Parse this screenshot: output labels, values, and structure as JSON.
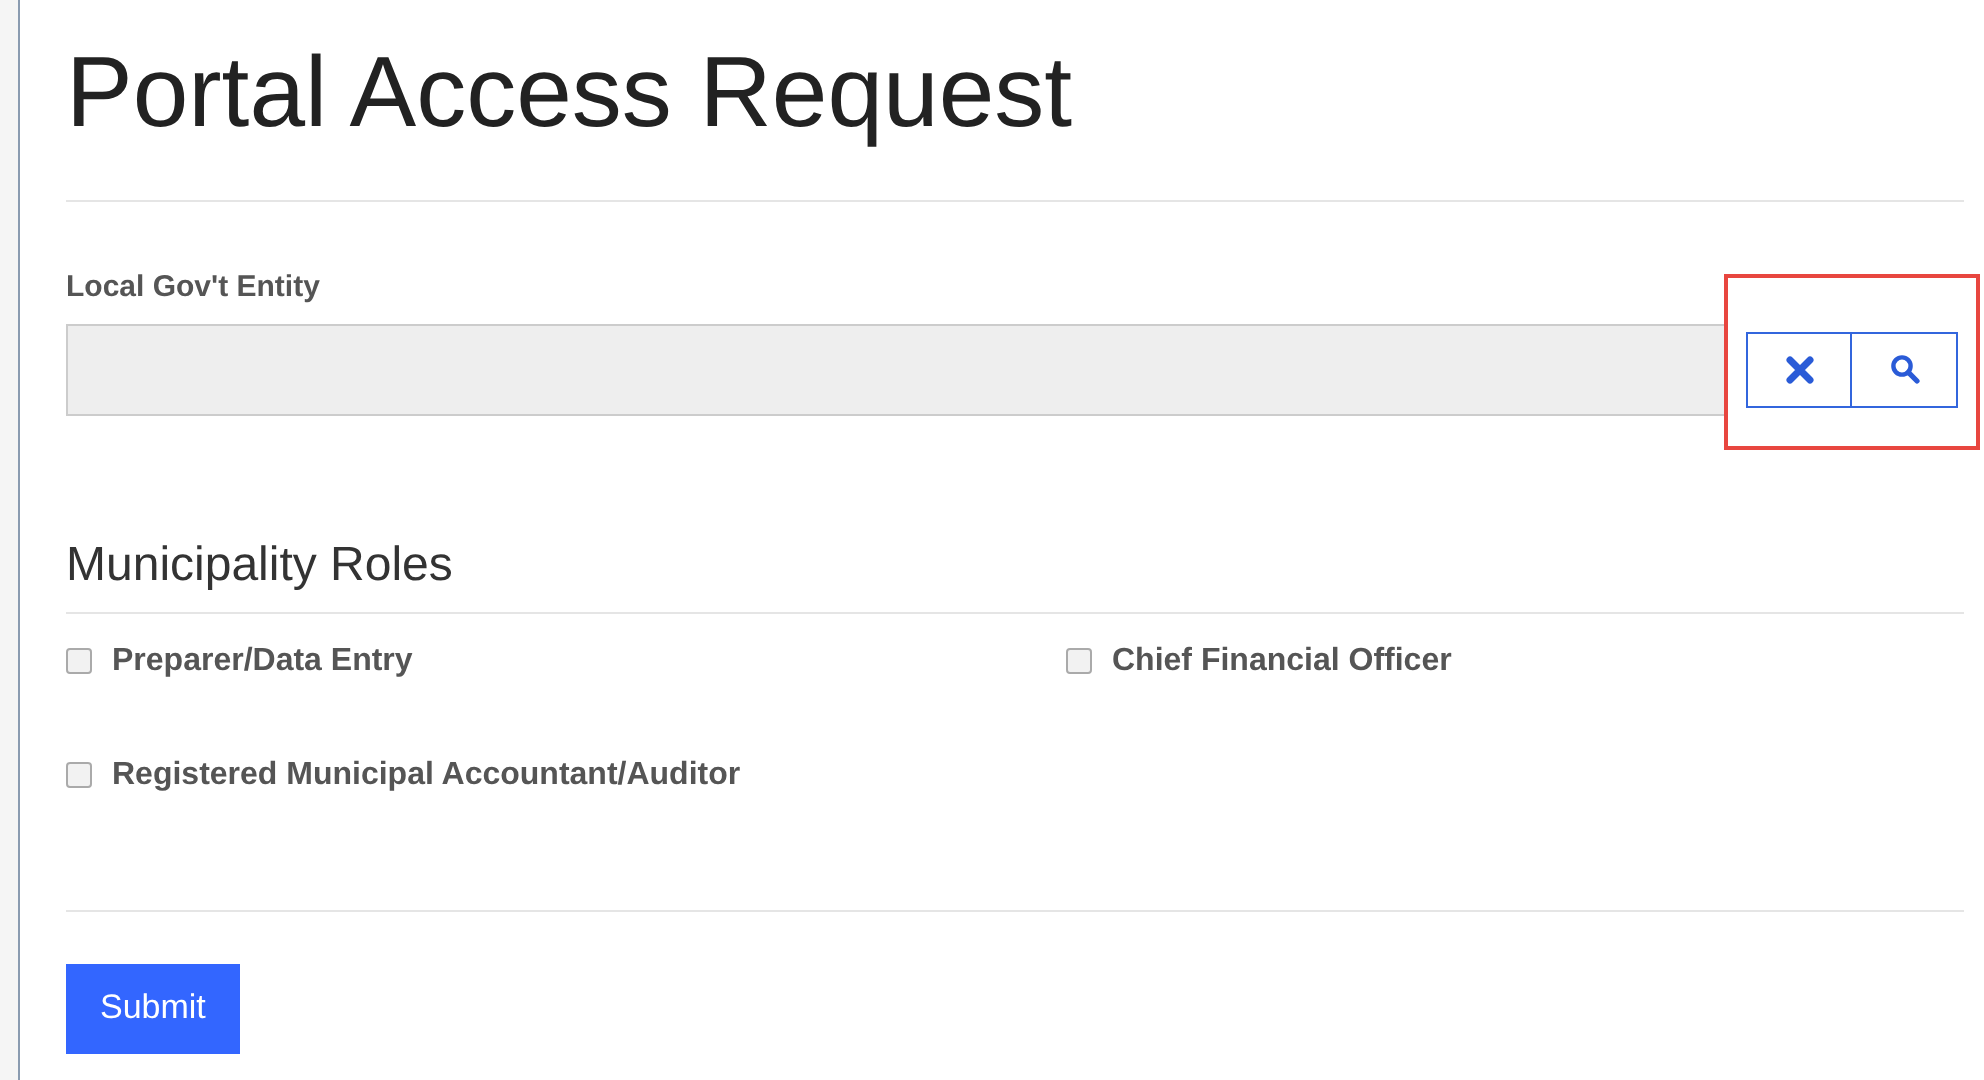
{
  "title": "Portal Access Request",
  "entity_field": {
    "label": "Local Gov't Entity"
  },
  "roles": {
    "heading": "Municipality Roles",
    "options": [
      {
        "label": "Preparer/Data Entry",
        "checked": false
      },
      {
        "label": "Chief Financial Officer",
        "checked": false
      },
      {
        "label": "Registered Municipal Accountant/Auditor",
        "checked": false
      }
    ]
  },
  "submit": {
    "label": "Submit"
  }
}
